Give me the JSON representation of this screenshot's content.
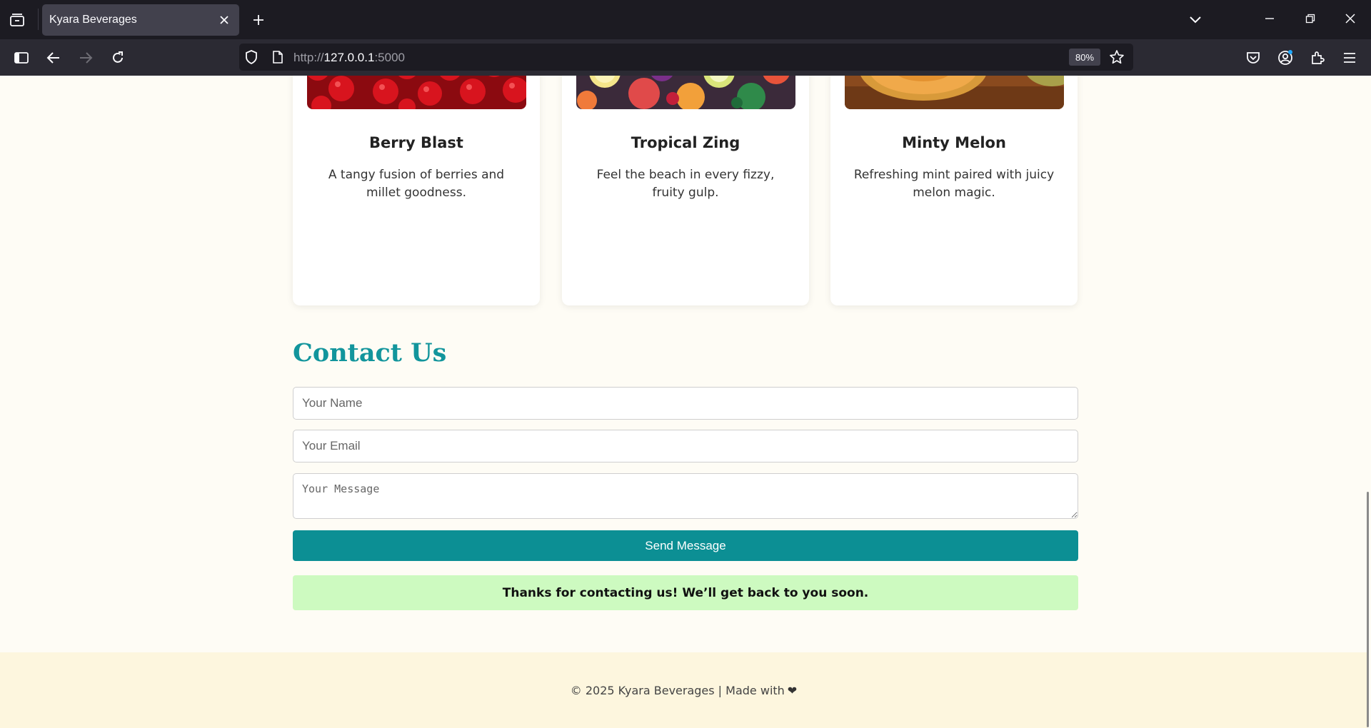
{
  "browser": {
    "tab_title": "Kyara Beverages",
    "url_scheme": "http://",
    "url_host": "127.0.0.1",
    "url_port": ":5000",
    "zoom": "80%"
  },
  "cards": [
    {
      "title": "Berry Blast",
      "description": "A tangy fusion of berries and millet goodness.",
      "image": "red-berries-photo"
    },
    {
      "title": "Tropical Zing",
      "description": "Feel the beach in every fizzy, fruity gulp.",
      "image": "tropical-fruits-photo"
    },
    {
      "title": "Minty Melon",
      "description": "Refreshing mint paired with juicy melon magic.",
      "image": "melon-photo"
    }
  ],
  "contact": {
    "title": "Contact Us",
    "name_placeholder": "Your Name",
    "email_placeholder": "Your Email",
    "message_placeholder": "Your Message",
    "send_label": "Send Message",
    "success_message": "Thanks for contacting us! We’ll get back to you soon."
  },
  "footer": {
    "text": "© 2025 Kyara Beverages | Made with ",
    "heart": "❤"
  },
  "colors": {
    "accent": "#0c8f94",
    "success_bg": "#cdfac0",
    "footer_bg": "#fdf6de",
    "page_bg": "#fefcf5"
  }
}
